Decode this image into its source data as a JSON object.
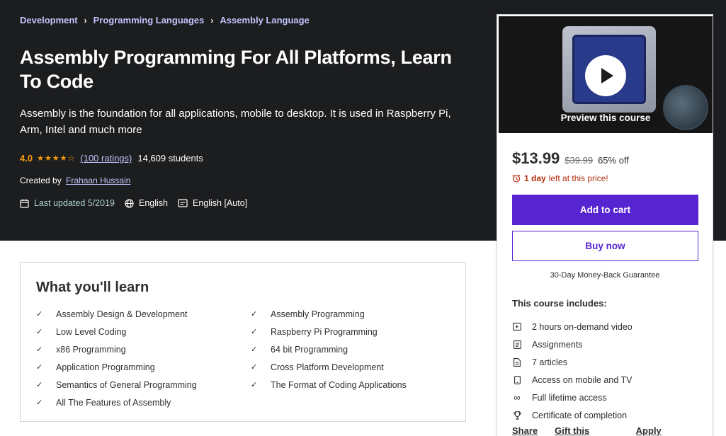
{
  "breadcrumb": [
    "Development",
    "Programming Languages",
    "Assembly Language"
  ],
  "course": {
    "title": "Assembly Programming For All Platforms, Learn To Code",
    "subtitle": "Assembly is the foundation for all applications, mobile to desktop. It is used in Raspberry Pi, Arm, Intel and much more",
    "rating": "4.0",
    "rating_stars": 4,
    "ratings_count": "(100 ratings)",
    "students": "14,609 students",
    "created_by_label": "Created by",
    "instructor": "Frahaan Hussain",
    "last_updated": "Last updated 5/2019",
    "language": "English",
    "captions": "English [Auto]"
  },
  "learn": {
    "title": "What you'll learn",
    "items": [
      "Assembly Design & Development",
      "Assembly Programming",
      "Low Level Coding",
      "Raspberry Pi Programming",
      "x86 Programming",
      "64 bit Programming",
      "Application Programming",
      "Cross Platform Development",
      "Semantics of General Programming",
      "The Format of Coding Applications",
      "All The Features of Assembly"
    ]
  },
  "sidebar": {
    "preview_label": "Preview this course",
    "price": "$13.99",
    "original_price": "$39.99",
    "discount": "65% off",
    "timer_bold": "1 day",
    "timer_rest": "left at this price!",
    "add_to_cart": "Add to cart",
    "buy_now": "Buy now",
    "guarantee": "30-Day Money-Back Guarantee",
    "includes_title": "This course includes:",
    "includes": [
      {
        "icon": "video-icon",
        "label": "2 hours on-demand video"
      },
      {
        "icon": "assignment-icon",
        "label": "Assignments"
      },
      {
        "icon": "article-icon",
        "label": "7 articles"
      },
      {
        "icon": "mobile-icon",
        "label": "Access on mobile and TV"
      },
      {
        "icon": "infinity-icon",
        "label": "Full lifetime access"
      },
      {
        "icon": "trophy-icon",
        "label": "Certificate of completion"
      }
    ],
    "share": "Share",
    "gift": "Gift this course",
    "coupon": "Apply Coupon"
  },
  "colors": {
    "hero_bg": "#1c1d1f",
    "accent": "#5624d0",
    "link": "#c0c4fc",
    "star": "#f69c08",
    "urgent": "#b32d0f"
  }
}
